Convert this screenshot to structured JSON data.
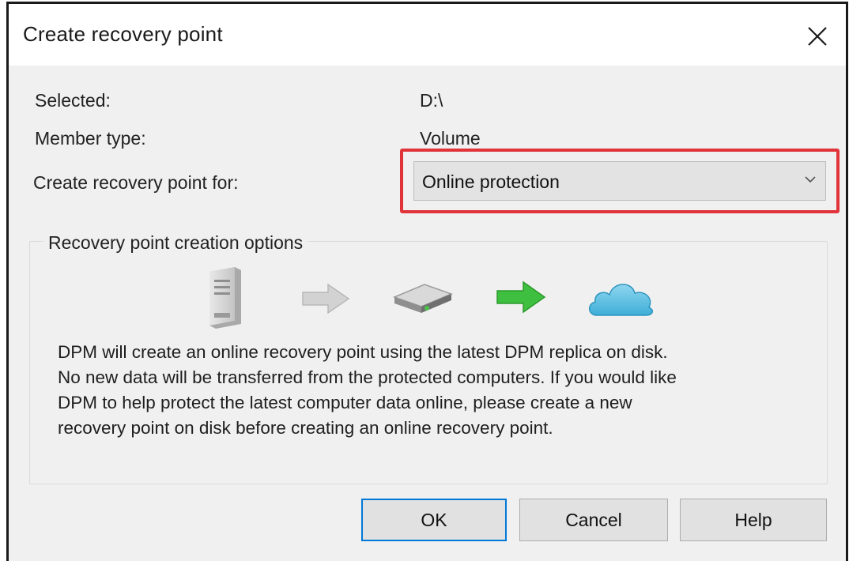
{
  "dialog": {
    "title": "Create recovery point",
    "close_icon": "close-icon"
  },
  "fields": {
    "selected_label": "Selected:",
    "selected_value": "D:\\",
    "member_type_label": "Member type:",
    "member_type_value": "Volume",
    "create_for_label": "Create recovery point for:",
    "create_for_value": "Online protection"
  },
  "options_group": {
    "title": "Recovery point creation options",
    "icons": [
      "server-icon",
      "gray-arrow-icon",
      "disk-drive-icon",
      "green-arrow-icon",
      "cloud-icon"
    ],
    "description_lines": [
      "DPM will create an online recovery point using the latest DPM replica on disk.",
      "No new data will be transferred from the protected computers. If you would like",
      "DPM to help protect the latest computer data online, please create a new",
      "recovery point on disk before creating an online recovery point."
    ]
  },
  "buttons": {
    "ok": "OK",
    "cancel": "Cancel",
    "help": "Help"
  },
  "colors": {
    "highlight_border": "#e0343a",
    "default_button_border": "#0078d7",
    "dialog_background": "#f0f0f0"
  }
}
